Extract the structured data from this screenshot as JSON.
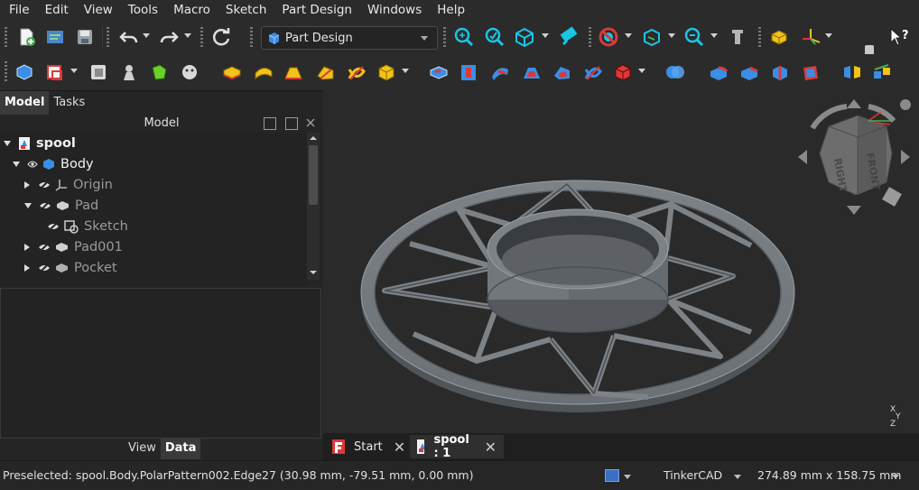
{
  "menu": [
    "File",
    "Edit",
    "View",
    "Tools",
    "Macro",
    "Sketch",
    "Part Design",
    "Windows",
    "Help"
  ],
  "workbench": {
    "selected": "Part Design"
  },
  "toolbar1_icons": [
    "new-document-icon",
    "open-document-icon",
    "save-icon",
    "undo-icon",
    "redo-icon",
    "refresh-icon",
    "fit-all-icon",
    "fit-selection-icon",
    "isometric-view-icon",
    "measure-icon",
    "draw-style-icon",
    "bounding-box-icon",
    "zoom-icon",
    "clip-plane-icon",
    "part-icon",
    "axis-cross-icon",
    "whats-this-icon"
  ],
  "toolbar2_icons": [
    "body-icon",
    "sketch-icon",
    "clone-icon",
    "shape-binder-icon",
    "sub-shape-binder-icon",
    "curve-icon",
    "pad-icon",
    "revolution-icon",
    "loft-icon",
    "pipe-icon",
    "helix-icon",
    "additive-primitive-icon",
    "pocket-icon",
    "hole-icon",
    "groove-icon",
    "subtractive-loft-icon",
    "subtractive-pipe-icon",
    "subtractive-helix-icon",
    "subtractive-primitive-icon",
    "boolean-icon",
    "fillet-icon",
    "chamfer-icon",
    "draft-icon",
    "thickness-icon",
    "mirrored-icon",
    "linear-pattern-icon"
  ],
  "combo": {
    "tabs": [
      "Model",
      "Tasks"
    ],
    "header": "Model",
    "tree": [
      {
        "label": "spool",
        "level": 0,
        "arrow": "down",
        "bold": true,
        "dim": false
      },
      {
        "label": "Body",
        "level": 1,
        "arrow": "down",
        "bold": false,
        "dim": false
      },
      {
        "label": "Origin",
        "level": 2,
        "arrow": "right",
        "bold": false,
        "dim": true
      },
      {
        "label": "Pad",
        "level": 2,
        "arrow": "down",
        "bold": false,
        "dim": true
      },
      {
        "label": "Sketch",
        "level": 3,
        "arrow": "none",
        "bold": false,
        "dim": true
      },
      {
        "label": "Pad001",
        "level": 2,
        "arrow": "right",
        "bold": false,
        "dim": true
      },
      {
        "label": "Pocket",
        "level": 2,
        "arrow": "right",
        "bold": false,
        "dim": true
      }
    ],
    "property_tabs": [
      "View",
      "Data"
    ]
  },
  "navcube": {
    "faces": [
      "FRONT",
      "RIGHT",
      "TOP"
    ]
  },
  "axis_label": {
    "x": "X",
    "y": "Y",
    "z": "Z"
  },
  "doc_tabs": [
    {
      "label": "Start",
      "close": "✕"
    },
    {
      "label": "spool : 1",
      "close": "✕"
    }
  ],
  "status": {
    "preselected": "Preselected: spool.Body.PolarPattern002.Edge27 (30.98 mm, -79.51 mm, 0.00 mm)",
    "navigation": "TinkerCAD",
    "dimensions": "274.89 mm x 158.75 mm"
  },
  "colors": {
    "accent_blue": "#3a8ee6",
    "part_yellow": "#f2c21b",
    "part_red": "#d83a3a",
    "model_grey": "#7d8287",
    "background": "#2a2a2a"
  }
}
